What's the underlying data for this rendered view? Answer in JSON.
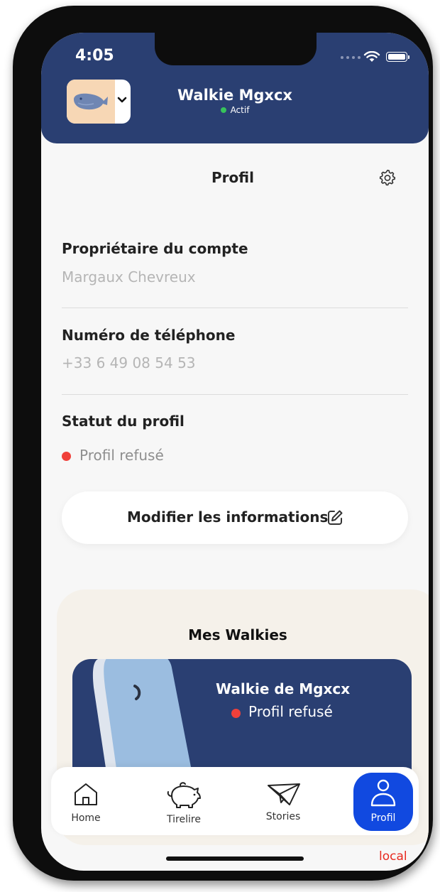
{
  "status_bar": {
    "time": "4:05"
  },
  "header": {
    "name": "Walkie Mgxcx",
    "status": "Actif"
  },
  "page": {
    "title": "Profil"
  },
  "fields": [
    {
      "label": "Propriétaire du compte",
      "value": "Margaux Chevreux"
    },
    {
      "label": "Numéro de téléphone",
      "value": "+33 6 49 08 54 53"
    },
    {
      "label": "Statut du profil",
      "value": "Profil refusé"
    }
  ],
  "edit_button": {
    "label": "Modifier les informations"
  },
  "walkies": {
    "title": "Mes Walkies",
    "card": {
      "name": "Walkie de Mgxcx",
      "status": "Profil refusé"
    }
  },
  "tabs": [
    {
      "label": "Home",
      "icon": "home-icon"
    },
    {
      "label": "Tirelire",
      "icon": "piggy-bank-icon"
    },
    {
      "label": "Stories",
      "icon": "paper-plane-icon"
    },
    {
      "label": "Profil",
      "icon": "user-icon",
      "active": true
    }
  ],
  "env_label": "local",
  "colors": {
    "header_bg": "#2a3f72",
    "active_tab": "#1149e0",
    "status_active": "#37c35b",
    "status_refused": "#f0403a",
    "env_label": "#e8281e"
  }
}
